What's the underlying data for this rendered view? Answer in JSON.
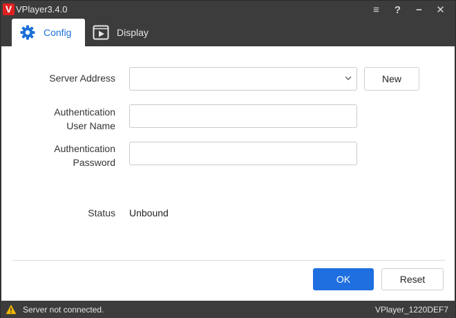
{
  "app": {
    "logo_letter": "V",
    "title": "VPlayer3.4.0"
  },
  "window_controls": {
    "menu_icon": "≡",
    "help_icon": "?",
    "minimize_icon": "−",
    "close_icon": "✕"
  },
  "tabs": [
    {
      "label": "Config",
      "icon": "gear-icon",
      "active": true
    },
    {
      "label": "Display",
      "icon": "display-icon",
      "active": false
    }
  ],
  "form": {
    "server_address": {
      "label": "Server Address",
      "value": "",
      "placeholder": ""
    },
    "new_button": "New",
    "auth_user": {
      "label_line1": "Authentication",
      "label_line2": "User Name",
      "value": ""
    },
    "auth_password": {
      "label_line1": "Authentication",
      "label_line2": "Password",
      "value": ""
    },
    "status": {
      "label": "Status",
      "value": "Unbound"
    }
  },
  "actions": {
    "ok": "OK",
    "reset": "Reset"
  },
  "statusbar": {
    "message": "Server not connected.",
    "device_id": "VPlayer_1220DEF7"
  },
  "colors": {
    "accent": "#1f6fe0",
    "logo": "#e02020",
    "warning": "#f5b800",
    "chrome": "#3c3c3c"
  }
}
